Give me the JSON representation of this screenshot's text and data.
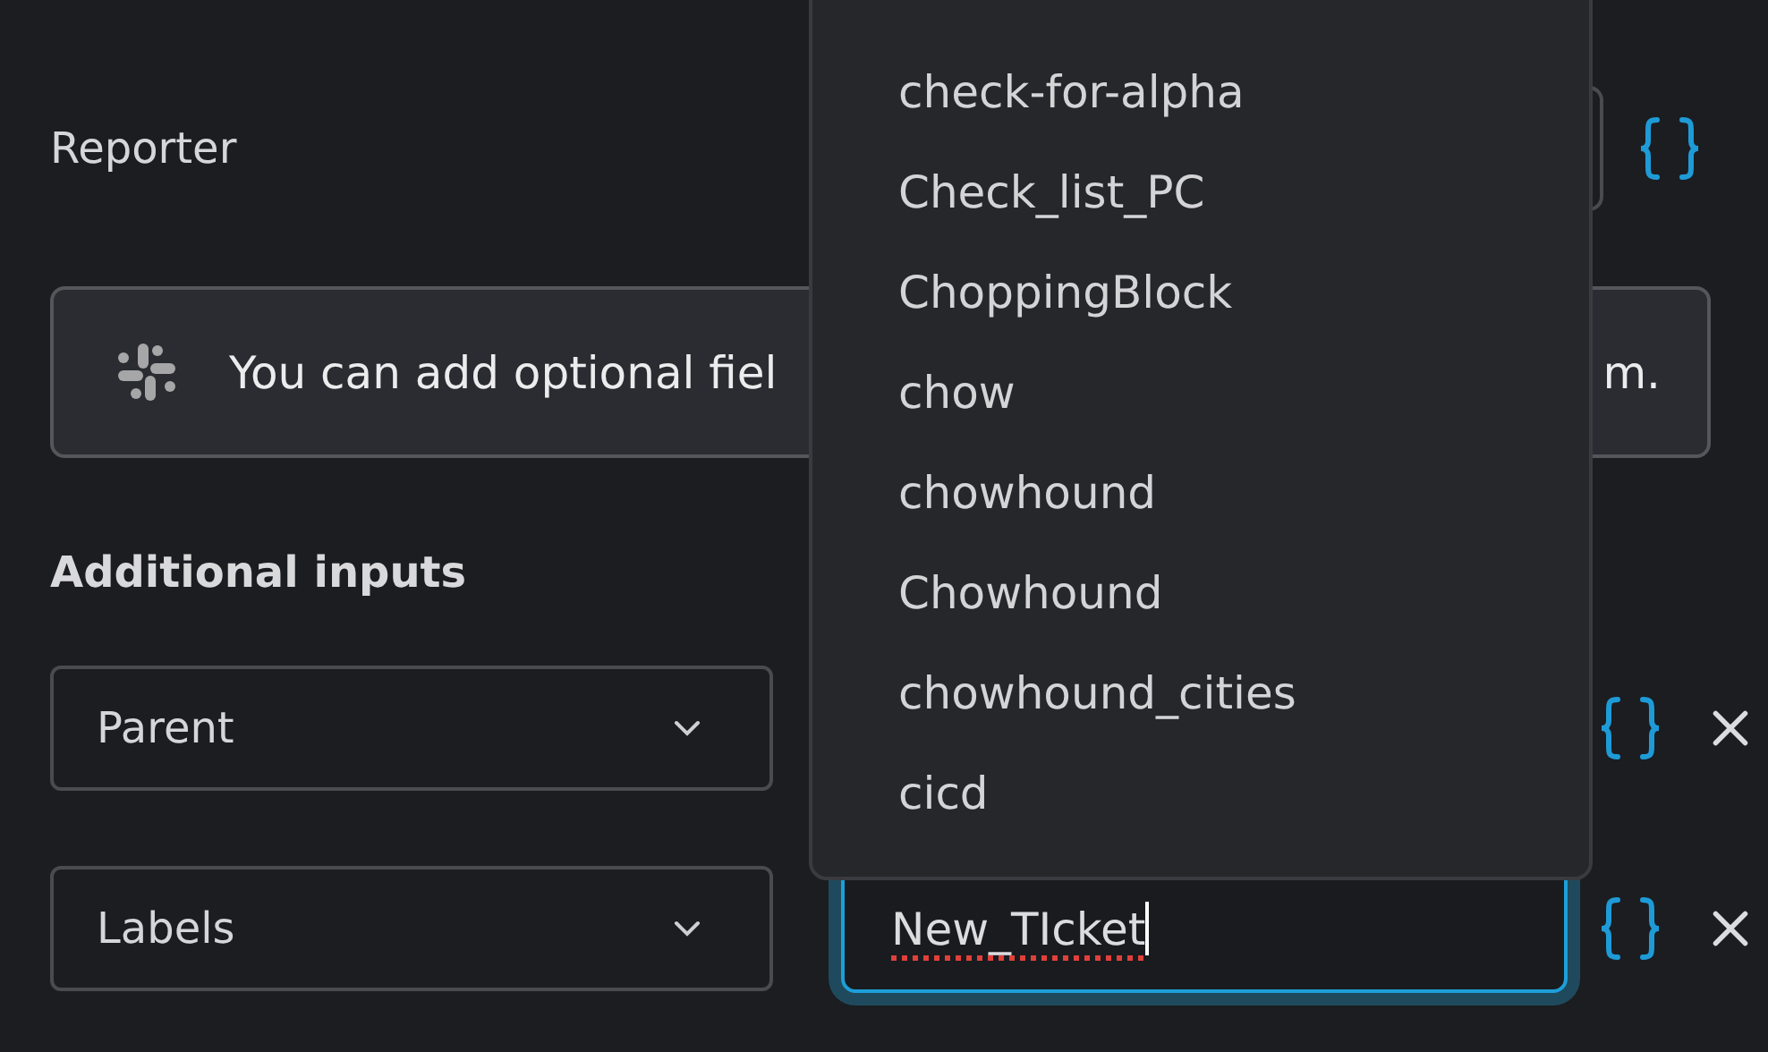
{
  "reporter": {
    "label": "Reporter"
  },
  "notice": {
    "text_start": "You can add optional fiel",
    "text_end": "m."
  },
  "additional_inputs": {
    "heading": "Additional inputs",
    "rows": [
      {
        "field": "Parent"
      },
      {
        "field": "Labels",
        "value": "New_TIcket",
        "focused": true,
        "spellcheck_error": true
      }
    ]
  },
  "dropdown": {
    "options": [
      "check-for-alpha",
      "Check_list_PC",
      "ChoppingBlock",
      "chow",
      "chowhound",
      "Chowhound",
      "chowhound_cities",
      "cicd"
    ]
  }
}
